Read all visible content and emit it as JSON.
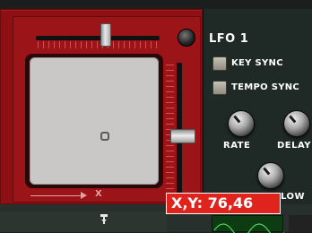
{
  "xy_pad": {
    "x_axis_label": "X",
    "readout": "X,Y: 76,46",
    "x_value": 76,
    "y_value": 46
  },
  "lfo": {
    "title": "LFO 1",
    "key_sync_label": "KEY SYNC",
    "tempo_sync_label": "TEMPO SYNC",
    "knobs": [
      {
        "label": "RATE"
      },
      {
        "label": "DELAY"
      },
      {
        "label": "LOW"
      }
    ]
  },
  "colors": {
    "device_red": "#8c1014",
    "tooltip_red": "#e0241d",
    "lfo_panel": "#1f2a26"
  },
  "icons": {
    "corner_knob": "knob-icon",
    "bottom_pin": "pin-icon"
  }
}
